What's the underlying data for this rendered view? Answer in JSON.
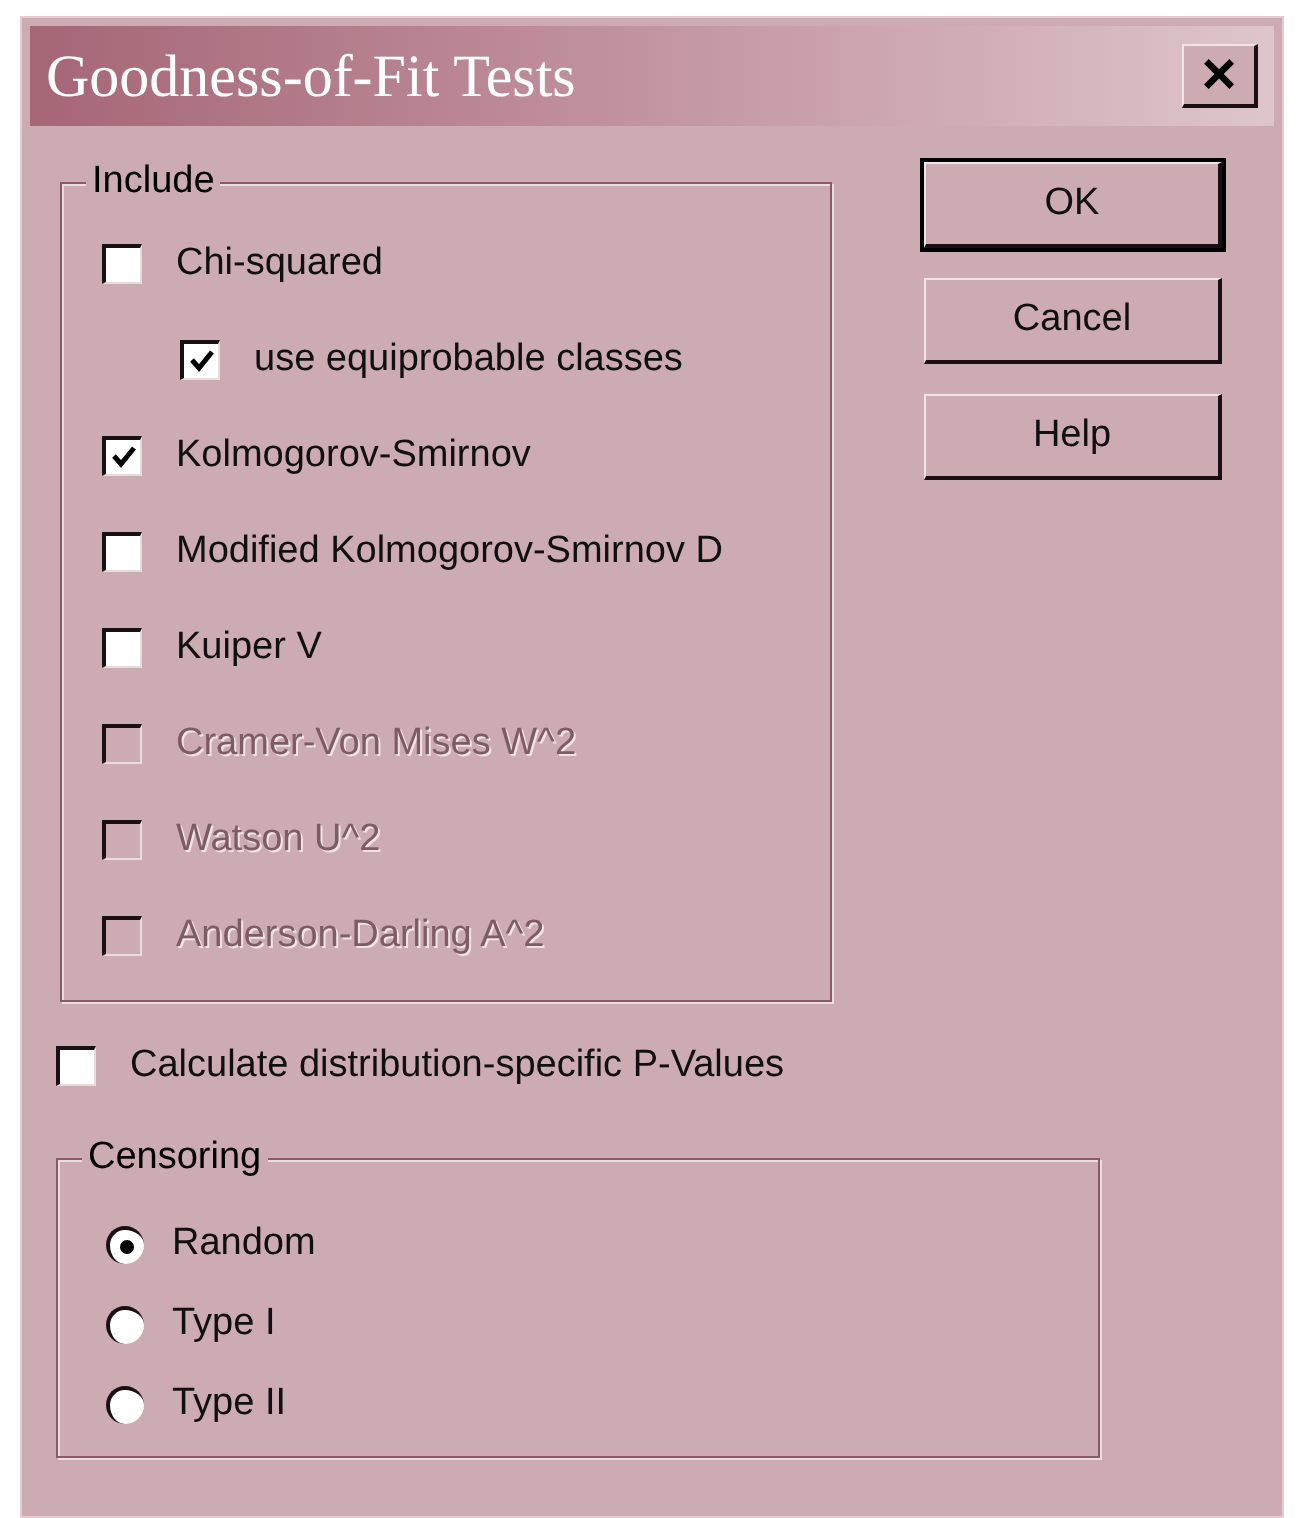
{
  "window": {
    "title": "Goodness-of-Fit Tests",
    "close": "×"
  },
  "include": {
    "label": "Include",
    "items": [
      {
        "label": "Chi-squared",
        "checked": false,
        "disabled": false,
        "children": [
          {
            "label": "use equiprobable classes",
            "checked": true,
            "disabled": false
          }
        ]
      },
      {
        "label": "Kolmogorov-Smirnov",
        "checked": true,
        "disabled": false
      },
      {
        "label": "Modified Kolmogorov-Smirnov D",
        "checked": false,
        "disabled": false
      },
      {
        "label": "Kuiper V",
        "checked": false,
        "disabled": false
      },
      {
        "label": "Cramer-Von Mises W^2",
        "checked": false,
        "disabled": true
      },
      {
        "label": "Watson U^2",
        "checked": false,
        "disabled": true
      },
      {
        "label": "Anderson-Darling A^2",
        "checked": false,
        "disabled": true
      }
    ]
  },
  "buttons": [
    {
      "label": "OK",
      "default": true
    },
    {
      "label": "Cancel",
      "default": false
    },
    {
      "label": "Help",
      "default": false
    }
  ],
  "p_values": {
    "label": "Calculate distribution-specific P-Values",
    "checked": false
  },
  "censoring": {
    "label": "Censoring",
    "options": [
      {
        "label": "Random",
        "selected": true
      },
      {
        "label": "Type I",
        "selected": false
      },
      {
        "label": "Type II",
        "selected": false
      }
    ]
  }
}
